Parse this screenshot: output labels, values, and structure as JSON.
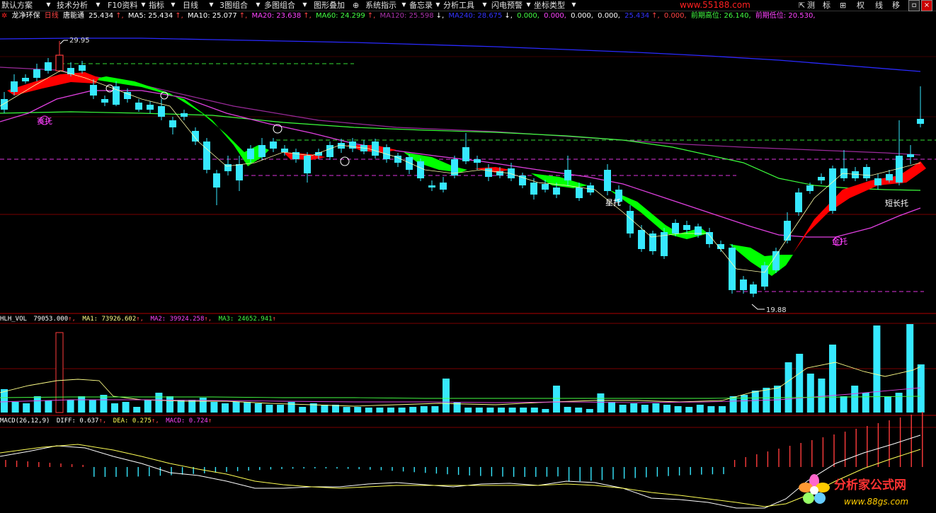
{
  "toolbar": {
    "items": [
      "默认方案",
      "技术分析",
      "F10资料",
      "指标",
      "日线",
      "3图组合",
      "多图组合",
      "图形叠加",
      "系统指示",
      "备忘录",
      "分析工具",
      "闪电预警",
      "坐标类型"
    ],
    "right_items": [
      "测",
      "标",
      "权",
      "线",
      "移"
    ],
    "watermark": "www.55188.com"
  },
  "header": {
    "stock_name": "龙净环保",
    "period": "日线",
    "indicator": "唐能通",
    "price": "25.434",
    "ma5": "MA5: 25.434",
    "ma10": "MA10: 25.077",
    "ma20": "MA20: 23.638",
    "ma60": "MA60: 24.299",
    "ma120": "MA120: 25.598",
    "ma240": "MA240: 28.675",
    "v1": "0.000,",
    "v2": "0.000,",
    "v3": "0.000,",
    "v4": "0.000,",
    "v5": "25.434",
    "v6": "0.000,",
    "prev_high": "前期高位: 26.140,",
    "prev_low": "前期低位: 20.530,"
  },
  "annotations": {
    "high": "29.95",
    "low": "19.88",
    "label_xinyang": "星托",
    "label_zhongchang": "短长托",
    "label_huyang": "金托",
    "label_yangtuo": "赛托"
  },
  "volume_panel": {
    "title": "HLH_VOL",
    "value": "79053.000",
    "ma1": "MA1: 73926.602",
    "ma2": "MA2: 39924.258",
    "ma3": "MA3: 24652.941"
  },
  "macd_panel": {
    "title": "MACD(26,12,9)",
    "diff": "DIFF: 0.637",
    "dea": "DEA: 0.275",
    "macd": "MACD: 0.724"
  },
  "logo": {
    "name": "分析家公式网",
    "url": "www.88gs.com"
  },
  "colors": {
    "up": "#ff3b3b",
    "down": "#36e8ff",
    "ma_green": "#3cff3c",
    "ma_magenta": "#e040e0",
    "ma_blue": "#2a2aff",
    "fill_green": "#00ff00",
    "fill_red": "#ff0000",
    "dashed_green": "#33dd33",
    "dashed_magenta": "#dd33dd"
  }
}
